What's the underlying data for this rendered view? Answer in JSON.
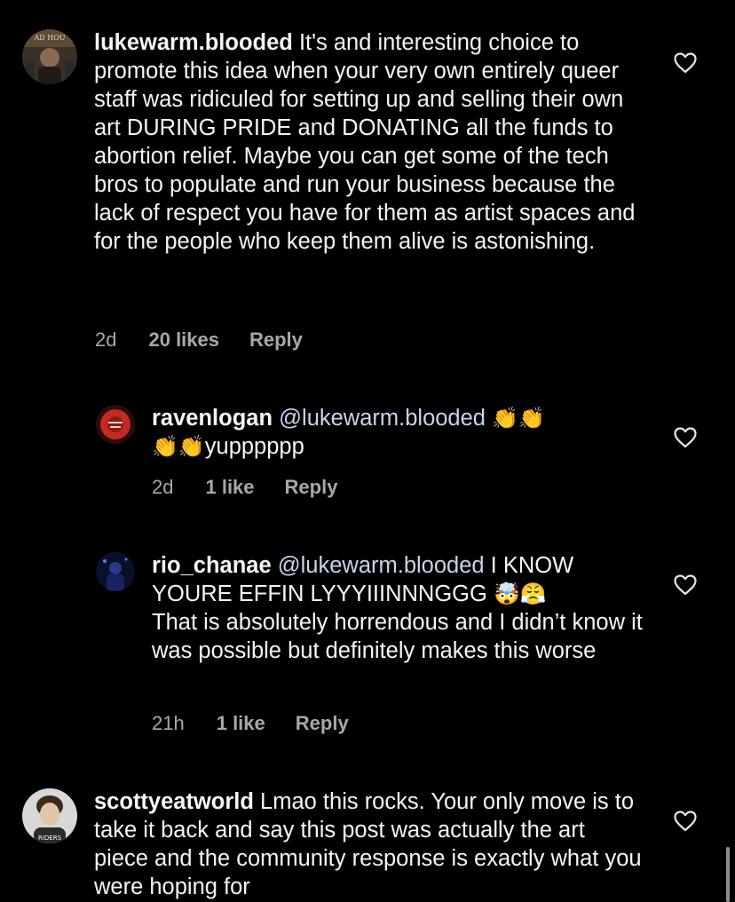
{
  "colors": {
    "background": "#000000",
    "text": "#f5f5f5",
    "muted": "#a8a8a8",
    "mention": "#c7d4ea"
  },
  "comments": [
    {
      "username": "lukewarm.blooded",
      "text": " It's and interesting choice to promote this idea when your very own entirely queer staff was ridiculed for setting up and selling their own art DURING PRIDE and DONATING all the funds to abortion relief. Maybe you can get some of the tech bros to populate and run your business because the lack of respect you have for them as artist spaces and for the people who keep them alive is astonishing.",
      "time": "2d",
      "likes": "20 likes",
      "reply": "Reply",
      "avatar_text": "AD HOU",
      "icon": "heart-outline-icon"
    },
    {
      "username": "ravenlogan",
      "mention": "@lukewarm.blooded",
      "emoji_a": "👏👏",
      "emoji_b": "👏👏",
      "text": "yupppppp",
      "time": "2d",
      "likes": "1 like",
      "reply": "Reply",
      "icon": "heart-outline-icon"
    },
    {
      "username": "rio_chanae",
      "mention": "@lukewarm.blooded",
      "text_a": " I KNOW YOURE EFFIN LYYYIIINNNGGG",
      "emoji": "🤯😤",
      "text_b": "That is absolutely horrendous and I didn’t know it was possible but definitely makes this worse",
      "time": "21h",
      "likes": "1 like",
      "reply": "Reply",
      "icon": "heart-outline-icon"
    },
    {
      "username": "scottyeatworld",
      "text": " Lmao this rocks. Your only move is to take it back and say this post was actually the art piece and the community response is exactly what you were hoping for",
      "avatar_text": "RIDERS",
      "icon": "heart-outline-icon"
    }
  ]
}
